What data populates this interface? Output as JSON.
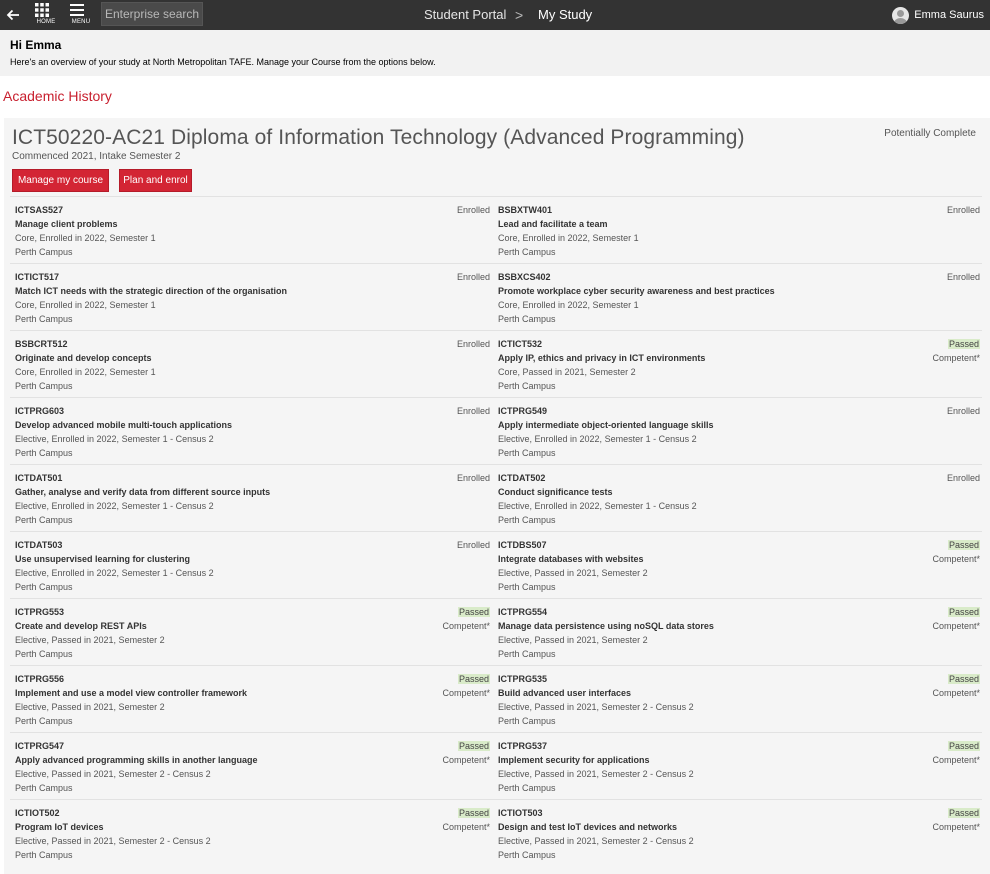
{
  "topbar": {
    "back_icon": "arrow-left-icon",
    "home_label": "HOME",
    "menu_label": "MENU",
    "search_placeholder": "Enterprise search",
    "breadcrumb": [
      "Student Portal",
      "My Study"
    ],
    "breadcrumb_separator": ">",
    "user_name": "Emma Saurus"
  },
  "welcome": {
    "greeting": "Hi Emma",
    "message": "Here's an overview of your study at North Metropolitan TAFE. Manage your Course from the options below."
  },
  "section_title": "Academic History",
  "course": {
    "title": "ICT50220-AC21 Diploma of Information Technology (Advanced Programming)",
    "status": "Potentially Complete",
    "subtitle": "Commenced 2021, Intake Semester 2",
    "buttons": {
      "manage": "Manage my course",
      "plan": "Plan and enrol"
    }
  },
  "colors": {
    "accent": "#d32534",
    "section_title": "#c8202f",
    "topbar": "#333333",
    "passed_bg": "#d9ebc9"
  },
  "units": [
    [
      {
        "code": "ICTSAS527",
        "name": "Manage client problems",
        "desc": "Core, Enrolled in 2022, Semester 1",
        "campus": "Perth Campus",
        "status": "Enrolled",
        "result": ""
      },
      {
        "code": "BSBXTW401",
        "name": "Lead and facilitate a team",
        "desc": "Core, Enrolled in 2022, Semester 1",
        "campus": "Perth Campus",
        "status": "Enrolled",
        "result": ""
      }
    ],
    [
      {
        "code": "ICTICT517",
        "name": "Match ICT needs with the strategic direction of the organisation",
        "desc": "Core, Enrolled in 2022, Semester 1",
        "campus": "Perth Campus",
        "status": "Enrolled",
        "result": ""
      },
      {
        "code": "BSBXCS402",
        "name": "Promote workplace cyber security awareness and best practices",
        "desc": "Core, Enrolled in 2022, Semester 1",
        "campus": "Perth Campus",
        "status": "Enrolled",
        "result": ""
      }
    ],
    [
      {
        "code": "BSBCRT512",
        "name": "Originate and develop concepts",
        "desc": "Core, Enrolled in 2022, Semester 1",
        "campus": "Perth Campus",
        "status": "Enrolled",
        "result": ""
      },
      {
        "code": "ICTICT532",
        "name": "Apply IP, ethics and privacy in ICT environments",
        "desc": "Core, Passed in 2021, Semester 2",
        "campus": "Perth Campus",
        "status": "Passed",
        "result": "Competent*"
      }
    ],
    [
      {
        "code": "ICTPRG603",
        "name": "Develop advanced mobile multi-touch applications",
        "desc": "Elective, Enrolled in 2022, Semester 1 - Census 2",
        "campus": "Perth Campus",
        "status": "Enrolled",
        "result": ""
      },
      {
        "code": "ICTPRG549",
        "name": "Apply intermediate object-oriented language skills",
        "desc": "Elective, Enrolled in 2022, Semester 1 - Census 2",
        "campus": "Perth Campus",
        "status": "Enrolled",
        "result": ""
      }
    ],
    [
      {
        "code": "ICTDAT501",
        "name": "Gather, analyse and verify data from different source inputs",
        "desc": "Elective, Enrolled in 2022, Semester 1 - Census 2",
        "campus": "Perth Campus",
        "status": "Enrolled",
        "result": ""
      },
      {
        "code": "ICTDAT502",
        "name": "Conduct significance tests",
        "desc": "Elective, Enrolled in 2022, Semester 1 - Census 2",
        "campus": "Perth Campus",
        "status": "Enrolled",
        "result": ""
      }
    ],
    [
      {
        "code": "ICTDAT503",
        "name": "Use unsupervised learning for clustering",
        "desc": "Elective, Enrolled in 2022, Semester 1 - Census 2",
        "campus": "Perth Campus",
        "status": "Enrolled",
        "result": ""
      },
      {
        "code": "ICTDBS507",
        "name": "Integrate databases with websites",
        "desc": "Elective, Passed in 2021, Semester 2",
        "campus": "Perth Campus",
        "status": "Passed",
        "result": "Competent*"
      }
    ],
    [
      {
        "code": "ICTPRG553",
        "name": "Create and develop REST APIs",
        "desc": "Elective, Passed in 2021, Semester 2",
        "campus": "Perth Campus",
        "status": "Passed",
        "result": "Competent*"
      },
      {
        "code": "ICTPRG554",
        "name": "Manage data persistence using noSQL data stores",
        "desc": "Elective, Passed in 2021, Semester 2",
        "campus": "Perth Campus",
        "status": "Passed",
        "result": "Competent*"
      }
    ],
    [
      {
        "code": "ICTPRG556",
        "name": "Implement and use a model view controller framework",
        "desc": "Elective, Passed in 2021, Semester 2",
        "campus": "Perth Campus",
        "status": "Passed",
        "result": "Competent*"
      },
      {
        "code": "ICTPRG535",
        "name": "Build advanced user interfaces",
        "desc": "Elective, Passed in 2021, Semester 2 - Census 2",
        "campus": "Perth Campus",
        "status": "Passed",
        "result": "Competent*"
      }
    ],
    [
      {
        "code": "ICTPRG547",
        "name": "Apply advanced programming skills in another language",
        "desc": "Elective, Passed in 2021, Semester 2 - Census 2",
        "campus": "Perth Campus",
        "status": "Passed",
        "result": "Competent*"
      },
      {
        "code": "ICTPRG537",
        "name": "Implement security for applications",
        "desc": "Elective, Passed in 2021, Semester 2 - Census 2",
        "campus": "Perth Campus",
        "status": "Passed",
        "result": "Competent*"
      }
    ],
    [
      {
        "code": "ICTIOT502",
        "name": "Program IoT devices",
        "desc": "Elective, Passed in 2021, Semester 2 - Census 2",
        "campus": "Perth Campus",
        "status": "Passed",
        "result": "Competent*"
      },
      {
        "code": "ICTIOT503",
        "name": "Design and test IoT devices and networks",
        "desc": "Elective, Passed in 2021, Semester 2 - Census 2",
        "campus": "Perth Campus",
        "status": "Passed",
        "result": "Competent*"
      }
    ]
  ]
}
